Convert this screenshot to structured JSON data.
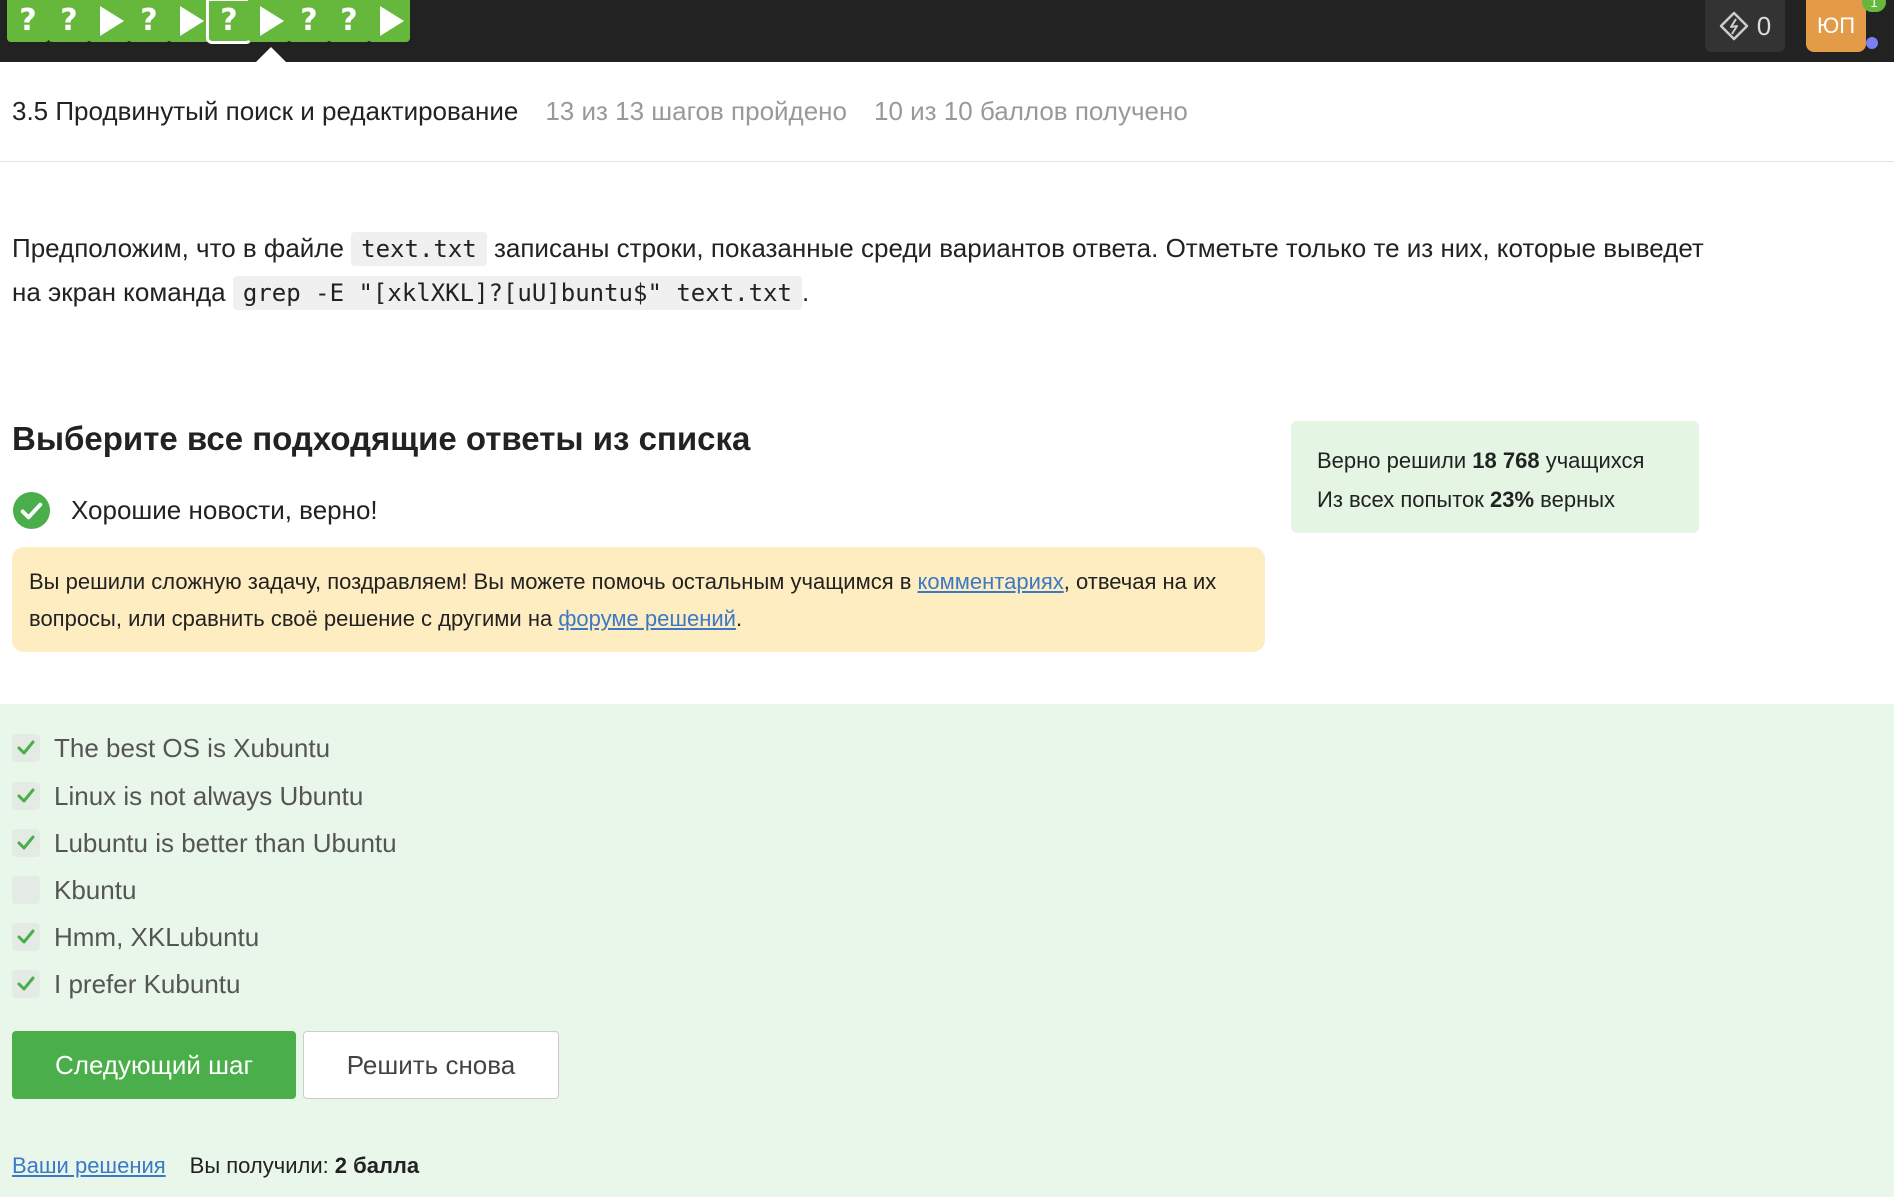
{
  "step_nav": {
    "steps": [
      {
        "type": "question",
        "symbol": "?"
      },
      {
        "type": "question",
        "symbol": "?"
      },
      {
        "type": "video",
        "symbol": ""
      },
      {
        "type": "question",
        "symbol": "?"
      },
      {
        "type": "video",
        "symbol": ""
      },
      {
        "type": "question",
        "symbol": "?",
        "active": true
      },
      {
        "type": "video",
        "symbol": ""
      },
      {
        "type": "question",
        "symbol": "?"
      },
      {
        "type": "question",
        "symbol": "?"
      },
      {
        "type": "video",
        "symbol": ""
      }
    ],
    "energy_count": "0",
    "avatar_initials": "ЮП",
    "notification_count": "1"
  },
  "lesson": {
    "title": "3.5 Продвинутый поиск и редактирование",
    "steps_progress": "13 из 13 шагов пройдено",
    "points_progress": "10 из 10 баллов  получено"
  },
  "task": {
    "text_1": "Предположим, что в файле ",
    "code_1": "text.txt",
    "text_2": " записаны строки, показанные среди вариантов ответа. Отметьте только те из них, которые выведет на экран команда ",
    "code_2": "grep -E \"[xklXKL]?[uU]buntu$\" text.txt",
    "text_3": "."
  },
  "quiz": {
    "title": "Выберите все подходящие ответы из списка",
    "success_message": "Хорошие новости, верно!",
    "notice_text_1": "Вы решили сложную задачу, поздравляем! Вы можете помочь остальным учащимся в ",
    "notice_link_1": "комментариях",
    "notice_text_2": ", отвечая на их вопросы, или сравнить своё решение с другими на ",
    "notice_link_2": "форуме решений",
    "notice_text_3": ".",
    "options": [
      {
        "label": "The best OS is Xubuntu",
        "checked": true
      },
      {
        "label": "Linux is not always Ubuntu",
        "checked": true
      },
      {
        "label": "Lubuntu is better than Ubuntu",
        "checked": true
      },
      {
        "label": "Kbuntu",
        "checked": false
      },
      {
        "label": "Hmm, XKLubuntu",
        "checked": true
      },
      {
        "label": "I prefer Kubuntu",
        "checked": true
      }
    ],
    "next_button": "Следующий шаг",
    "retry_button": "Решить снова",
    "your_solutions_link": "Ваши решения",
    "score_label": "Вы получили:",
    "score_value": "2 балла"
  },
  "stats": {
    "solved_prefix": "Верно решили ",
    "solved_count": "18 768",
    "solved_suffix": " учащихся",
    "attempts_prefix": "Из всех попыток ",
    "attempts_percent": "23%",
    "attempts_suffix": " верных"
  },
  "colors": {
    "topbar": "#222222",
    "step_green": "#66b83d",
    "accent_green": "#4aae4a",
    "answers_bg": "#e9f7ea",
    "notice_bg": "#ffedc2",
    "link": "#3b79c6"
  }
}
